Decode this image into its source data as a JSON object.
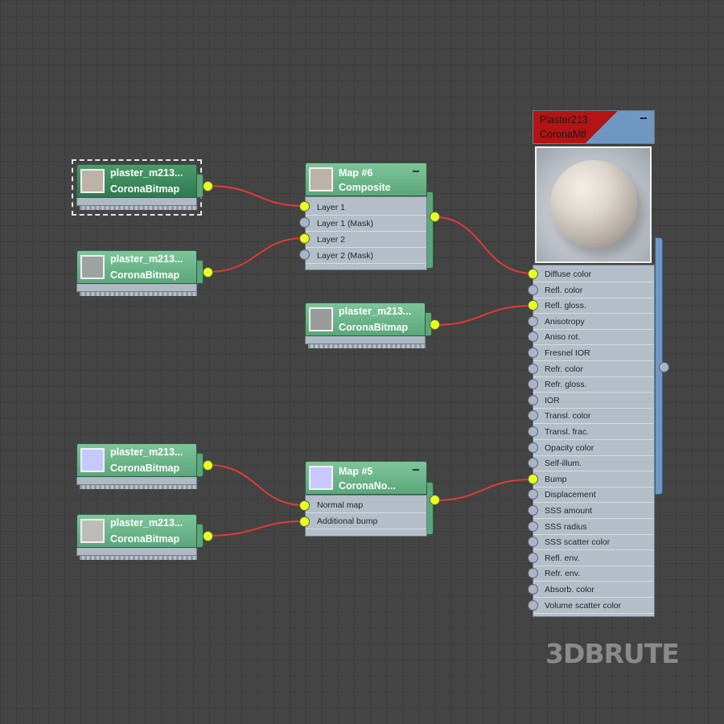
{
  "colors": {
    "wire": "#e23a3a",
    "socket_active": "#e8ff2a",
    "socket_inactive": "#aab4c4",
    "node_green": "#5aa77a",
    "material_header": "#b41414",
    "material_rail": "#6f98c3"
  },
  "bitmap_nodes": [
    {
      "name": "plaster_m213...",
      "type": "CoronaBitmap",
      "thumb": "#bdb2a6",
      "selected": true
    },
    {
      "name": "plaster_m213...",
      "type": "CoronaBitmap",
      "thumb": "#9ea3a0",
      "selected": false
    },
    {
      "name": "plaster_m213...",
      "type": "CoronaBitmap",
      "thumb": "#9a9b9b",
      "selected": false
    },
    {
      "name": "plaster_m213...",
      "type": "CoronaBitmap",
      "thumb": "#c6c8ff",
      "selected": false
    },
    {
      "name": "plaster_m213...",
      "type": "CoronaBitmap",
      "thumb": "#bcbcb8",
      "selected": false
    }
  ],
  "composite_node": {
    "name": "Map #6",
    "type": "Composite",
    "thumb": "#bdb2a6",
    "slots": [
      {
        "label": "Layer 1",
        "active": true
      },
      {
        "label": "Layer 1 (Mask)",
        "active": false
      },
      {
        "label": "Layer 2",
        "active": true
      },
      {
        "label": "Layer 2 (Mask)",
        "active": false
      }
    ]
  },
  "normal_node": {
    "name": "Map #5",
    "type": "CoronaNo...",
    "thumb": "#c6c8ff",
    "slots": [
      {
        "label": "Normal map",
        "active": true
      },
      {
        "label": "Additional bump",
        "active": true
      }
    ]
  },
  "material_node": {
    "name": "Plaster213",
    "type": "CoronaMtl",
    "slots": [
      {
        "label": "Diffuse color",
        "active": true
      },
      {
        "label": "Refl. color",
        "active": false
      },
      {
        "label": "Refl. gloss.",
        "active": true
      },
      {
        "label": "Anisotropy",
        "active": false
      },
      {
        "label": "Aniso rot.",
        "active": false
      },
      {
        "label": "Fresnel IOR",
        "active": false
      },
      {
        "label": "Refr. color",
        "active": false
      },
      {
        "label": "Refr. gloss.",
        "active": false
      },
      {
        "label": "IOR",
        "active": false
      },
      {
        "label": "Transl. color",
        "active": false
      },
      {
        "label": "Transl. frac.",
        "active": false
      },
      {
        "label": "Opacity color",
        "active": false
      },
      {
        "label": "Self-illum.",
        "active": false
      },
      {
        "label": "Bump",
        "active": true
      },
      {
        "label": "Displacement",
        "active": false
      },
      {
        "label": "SSS amount",
        "active": false
      },
      {
        "label": "SSS radius",
        "active": false
      },
      {
        "label": "SSS scatter color",
        "active": false
      },
      {
        "label": "Refl. env.",
        "active": false
      },
      {
        "label": "Refr. env.",
        "active": false
      },
      {
        "label": "Absorb. color",
        "active": false
      },
      {
        "label": "Volume scatter color",
        "active": false
      }
    ]
  },
  "watermark": "3DBRUTE"
}
